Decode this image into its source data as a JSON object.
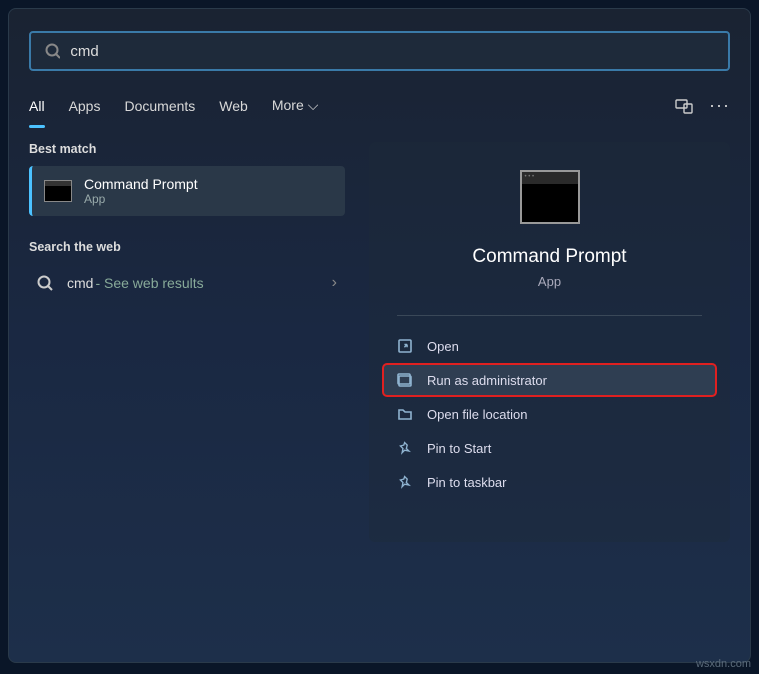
{
  "search": {
    "value": "cmd"
  },
  "tabs": {
    "items": [
      {
        "label": "All"
      },
      {
        "label": "Apps"
      },
      {
        "label": "Documents"
      },
      {
        "label": "Web"
      },
      {
        "label": "More"
      }
    ]
  },
  "left": {
    "best_match_label": "Best match",
    "best_match": {
      "title": "Command Prompt",
      "subtitle": "App"
    },
    "search_web_label": "Search the web",
    "web_item": {
      "query": "cmd",
      "suffix": " - See web results"
    }
  },
  "preview": {
    "title": "Command Prompt",
    "subtitle": "App",
    "actions": [
      {
        "label": "Open"
      },
      {
        "label": "Run as administrator"
      },
      {
        "label": "Open file location"
      },
      {
        "label": "Pin to Start"
      },
      {
        "label": "Pin to taskbar"
      }
    ]
  },
  "watermark": "wsxdn.com"
}
